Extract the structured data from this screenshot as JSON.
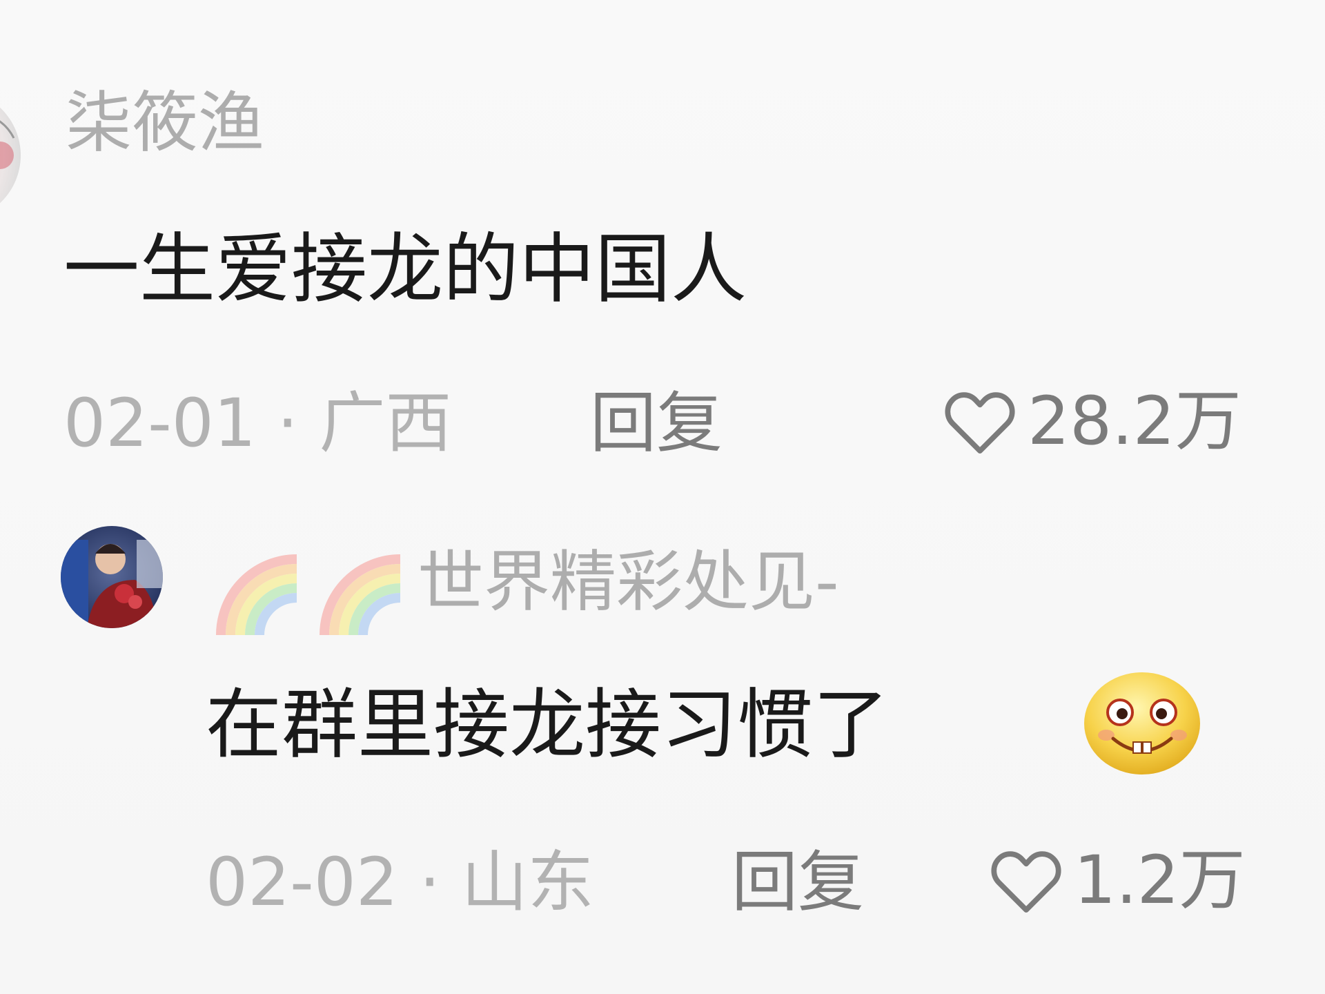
{
  "comments": [
    {
      "username": "柒筱渔",
      "text": "一生爱接龙的中国人",
      "date": "02-01",
      "separator": "·",
      "location": "广西",
      "reply_label": "回复",
      "likes": "28.2万"
    },
    {
      "username": "世界精彩处见-",
      "text": "在群里接龙接习惯了",
      "date": "02-02",
      "separator": "·",
      "location": "山东",
      "reply_label": "回复",
      "likes": "1.2万"
    }
  ],
  "icons": {
    "like": "heart-outline-icon",
    "name_decoration": "rainbow-emoji",
    "comment_emoji": "grinning-face-emoji"
  },
  "colors": {
    "username": "#adadad",
    "text": "#1a1a1a",
    "meta": "#b2b2b2",
    "action": "#7b7b7b"
  }
}
